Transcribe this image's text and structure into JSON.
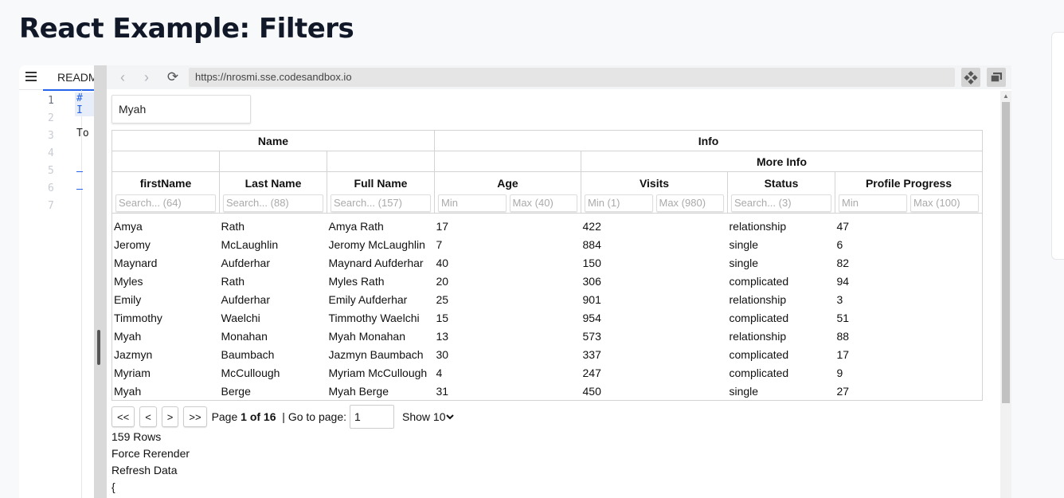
{
  "page": {
    "title": "React Example: Filters"
  },
  "editor": {
    "tab_label": "READM",
    "line_numbers": [
      "1",
      "2",
      "3",
      "4",
      "5",
      "6",
      "7"
    ],
    "line1_text": "# I",
    "line3_text": "To"
  },
  "browser": {
    "url": "https://nrosmi.sse.codesandbox.io",
    "back_icon": "‹",
    "forward_icon": "›",
    "reload_icon": "⟳"
  },
  "filters": {
    "global_value": "Myah"
  },
  "table": {
    "group_headers": {
      "name": "Name",
      "info": "Info",
      "more_info": "More Info"
    },
    "columns": {
      "first_name": {
        "label": "firstName",
        "placeholder": "Search... (64)"
      },
      "last_name": {
        "label": "Last Name",
        "placeholder": "Search... (88)"
      },
      "full_name": {
        "label": "Full Name",
        "placeholder": "Search... (157)"
      },
      "age": {
        "label": "Age",
        "min_placeholder": "Min",
        "max_placeholder": "Max (40)"
      },
      "visits": {
        "label": "Visits",
        "min_placeholder": "Min (1)",
        "max_placeholder": "Max (980)"
      },
      "status": {
        "label": "Status",
        "placeholder": "Search... (3)"
      },
      "progress": {
        "label": "Profile Progress",
        "min_placeholder": "Min",
        "max_placeholder": "Max (100)"
      }
    },
    "rows": [
      [
        "Amya",
        "Rath",
        "Amya Rath",
        "17",
        "422",
        "relationship",
        "47"
      ],
      [
        "Jeromy",
        "McLaughlin",
        "Jeromy McLaughlin",
        "7",
        "884",
        "single",
        "6"
      ],
      [
        "Maynard",
        "Aufderhar",
        "Maynard Aufderhar",
        "40",
        "150",
        "single",
        "82"
      ],
      [
        "Myles",
        "Rath",
        "Myles Rath",
        "20",
        "306",
        "complicated",
        "94"
      ],
      [
        "Emily",
        "Aufderhar",
        "Emily Aufderhar",
        "25",
        "901",
        "relationship",
        "3"
      ],
      [
        "Timmothy",
        "Waelchi",
        "Timmothy Waelchi",
        "15",
        "954",
        "complicated",
        "51"
      ],
      [
        "Myah",
        "Monahan",
        "Myah Monahan",
        "13",
        "573",
        "relationship",
        "88"
      ],
      [
        "Jazmyn",
        "Baumbach",
        "Jazmyn Baumbach",
        "30",
        "337",
        "complicated",
        "17"
      ],
      [
        "Myriam",
        "McCullough",
        "Myriam McCullough",
        "4",
        "247",
        "complicated",
        "9"
      ],
      [
        "Myah",
        "Berge",
        "Myah Berge",
        "31",
        "450",
        "single",
        "27"
      ]
    ]
  },
  "pagination": {
    "first_label": "<<",
    "prev_label": "<",
    "next_label": ">",
    "last_label": ">>",
    "page_prefix": "Page",
    "page_status": "1 of 16",
    "goto_label": "| Go to page:",
    "goto_value": "1",
    "page_size_label": "Show 10",
    "page_size_options": [
      "Show 10"
    ]
  },
  "footer": {
    "rows_count": "159 Rows",
    "force_rerender": "Force Rerender",
    "refresh_data": "Refresh Data",
    "json_open": "{"
  }
}
